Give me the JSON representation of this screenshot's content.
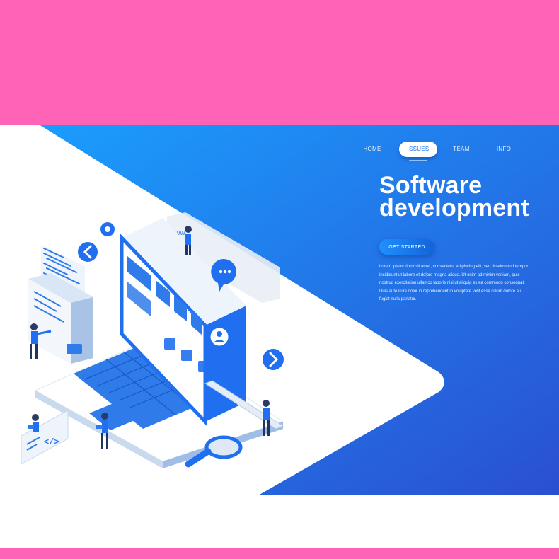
{
  "colors": {
    "pink_band": "#ff63b8",
    "hero_blue_light": "#1a8dff",
    "hero_blue_dark": "#2a4fd1",
    "panel_white": "#ffffff",
    "accent_blue": "#1f6ff0"
  },
  "nav": {
    "items": [
      {
        "label": "HOME",
        "active": false
      },
      {
        "label": "ISSUES",
        "active": true
      },
      {
        "label": "TEAM",
        "active": false
      },
      {
        "label": "INFO",
        "active": false
      }
    ]
  },
  "hero": {
    "title": "Software\ndevelopment",
    "cta_label": "GET STARTED",
    "description": "Lorem ipsum dolor sit amet, consectetur adipiscing elit, sed do eiusmod tempor incididunt ut labore et dolore magna aliqua. Ut enim ad minim veniam, quis nostrud exercitation ullamco laboris nisi ut aliquip ex ea commodo consequat. Duis aute irure dolor in reprehenderit in voluptate velit esse cillum dolore eu fugiat nulla pariatur."
  },
  "illustration": {
    "www_label": "www",
    "code_badge": "</>",
    "icons": [
      "chevron-left-icon",
      "chevron-right-icon",
      "gear-icon",
      "chat-bubble-icon",
      "magnifier-icon",
      "user-avatar-icon",
      "laptop-icon",
      "folder-icon"
    ]
  }
}
